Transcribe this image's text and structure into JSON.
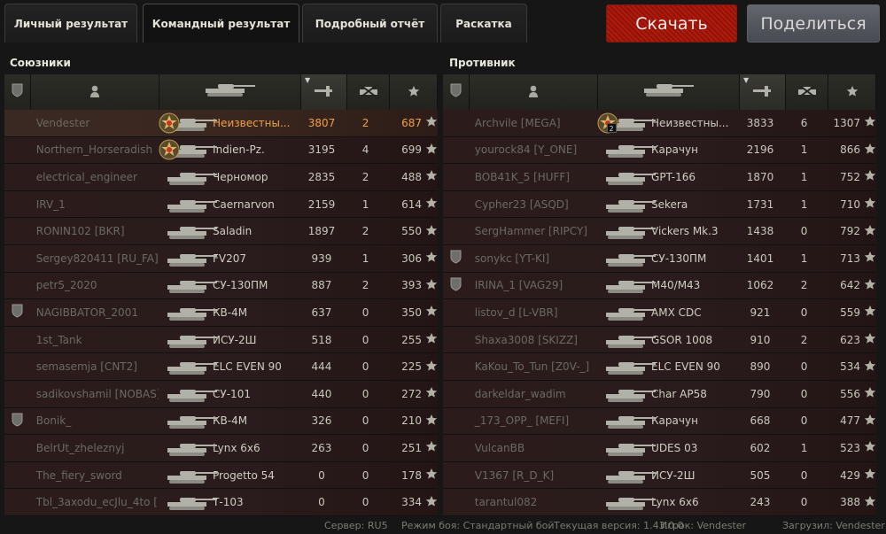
{
  "tabs": [
    "Личный результат",
    "Командный результат",
    "Подробный отчёт",
    "Раскатка"
  ],
  "active_tab": 1,
  "buttons": {
    "download": "Скачать",
    "share": "Поделиться"
  },
  "allies": {
    "title": "Союзники",
    "rows": [
      {
        "player": "Vendester",
        "vehicle": "Неизвестны...",
        "damage": "3807",
        "frags": "2",
        "xp": "687",
        "me": true,
        "medal": "mastery"
      },
      {
        "player": "Northern_Horseradish",
        "vehicle": "Indien-Pz.",
        "damage": "3195",
        "frags": "4",
        "xp": "699",
        "medal": "mastery"
      },
      {
        "player": "electrical_engineer",
        "vehicle": "Черномор",
        "damage": "2835",
        "frags": "2",
        "xp": "488"
      },
      {
        "player": "IRV_1",
        "vehicle": "Caernarvon",
        "damage": "2159",
        "frags": "1",
        "xp": "614"
      },
      {
        "player": "RONIN102 [BKR]",
        "vehicle": "Saladin",
        "damage": "1897",
        "frags": "2",
        "xp": "550"
      },
      {
        "player": "Sergey820411 [RU_FA]",
        "vehicle": "FV207",
        "damage": "939",
        "frags": "1",
        "xp": "306"
      },
      {
        "player": "petr5_2020",
        "vehicle": "СУ-130ПМ",
        "damage": "887",
        "frags": "2",
        "xp": "393"
      },
      {
        "player": "NAGIBBATOR_2001",
        "vehicle": "КВ-4М",
        "damage": "637",
        "frags": "0",
        "xp": "350",
        "badge": true
      },
      {
        "player": "1st_Tank",
        "vehicle": "ИСУ-2Ш",
        "damage": "518",
        "frags": "0",
        "xp": "255"
      },
      {
        "player": "semasemja [CNT2]",
        "vehicle": "ELC EVEN 90",
        "damage": "444",
        "frags": "0",
        "xp": "225"
      },
      {
        "player": "sadikovshamil [NOBAS]",
        "vehicle": "СУ-101",
        "damage": "440",
        "frags": "0",
        "xp": "272"
      },
      {
        "player": "Bonik_",
        "vehicle": "КВ-4М",
        "damage": "326",
        "frags": "0",
        "xp": "210",
        "badge": true
      },
      {
        "player": "BelrUt_zheleznyj",
        "vehicle": "Lynx 6x6",
        "damage": "263",
        "frags": "0",
        "xp": "251"
      },
      {
        "player": "The_fiery_sword",
        "vehicle": "Progetto 54",
        "damage": "0",
        "frags": "0",
        "xp": "178"
      },
      {
        "player": "Tbl_3axodu_ecJlu_4to [...",
        "vehicle": "Т-103",
        "damage": "0",
        "frags": "0",
        "xp": "334"
      }
    ]
  },
  "enemies": {
    "title": "Противник",
    "rows": [
      {
        "player": "Archvile [MEGA]",
        "vehicle": "Неизвестны...",
        "damage": "3833",
        "frags": "6",
        "xp": "1307",
        "medal": "mastery2",
        "medal_num": "2"
      },
      {
        "player": "yourock84 [Y_ONE]",
        "vehicle": "Карачун",
        "damage": "2196",
        "frags": "1",
        "xp": "866"
      },
      {
        "player": "BOB41K_5 [HUFF]",
        "vehicle": "GPT-166",
        "damage": "1870",
        "frags": "1",
        "xp": "752"
      },
      {
        "player": "Cypher23 [ASQD]",
        "vehicle": "Sekera",
        "damage": "1731",
        "frags": "1",
        "xp": "710"
      },
      {
        "player": "SergHammer [RIPCY]",
        "vehicle": "Vickers Mk.3",
        "damage": "1438",
        "frags": "0",
        "xp": "792"
      },
      {
        "player": "sonykc [YT-KI]",
        "vehicle": "СУ-130ПМ",
        "damage": "1401",
        "frags": "1",
        "xp": "713",
        "badge": true
      },
      {
        "player": "IRINA_1 [VAG29]",
        "vehicle": "M40/M43",
        "damage": "1062",
        "frags": "2",
        "xp": "642",
        "badge": true
      },
      {
        "player": "listov_d [L-VBR]",
        "vehicle": "AMX CDC",
        "damage": "921",
        "frags": "0",
        "xp": "559"
      },
      {
        "player": "Shaxa3008 [SKIZZ]",
        "vehicle": "GSOR 1008",
        "damage": "910",
        "frags": "2",
        "xp": "623"
      },
      {
        "player": "KaKou_To_Tun [Z0V-_]",
        "vehicle": "ELC EVEN 90",
        "damage": "890",
        "frags": "0",
        "xp": "534"
      },
      {
        "player": "darkeldar_wadim",
        "vehicle": "Char AP58",
        "damage": "790",
        "frags": "0",
        "xp": "556"
      },
      {
        "player": "_173_OPP_ [MEFI]",
        "vehicle": "Карачун",
        "damage": "668",
        "frags": "0",
        "xp": "477"
      },
      {
        "player": "VulcanBB",
        "vehicle": "UDES 03",
        "damage": "602",
        "frags": "1",
        "xp": "523"
      },
      {
        "player": "V1367 [R_D_K]",
        "vehicle": "ИСУ-2Ш",
        "damage": "505",
        "frags": "0",
        "xp": "429"
      },
      {
        "player": "tarantul082",
        "vehicle": "Lynx 6x6",
        "damage": "243",
        "frags": "0",
        "xp": "388"
      }
    ]
  },
  "footer": {
    "server_label": "Сервер:",
    "server": "RU5",
    "mode_label": "Режим боя:",
    "mode": "Стандартный бой",
    "version_label": "Текущая версия:",
    "version": "1.43.0.0",
    "player_label": "Игрок:",
    "player": "Vendester",
    "uploads_label": "Загрузил:",
    "uploads": "Vendester"
  },
  "icons": {
    "rank": "shield-icon",
    "player": "player-silhouette-icon",
    "vehicle": "tank-icon",
    "damage": "gun-icon",
    "frags": "destroyed-tank-icon",
    "xp": "star-icon"
  }
}
